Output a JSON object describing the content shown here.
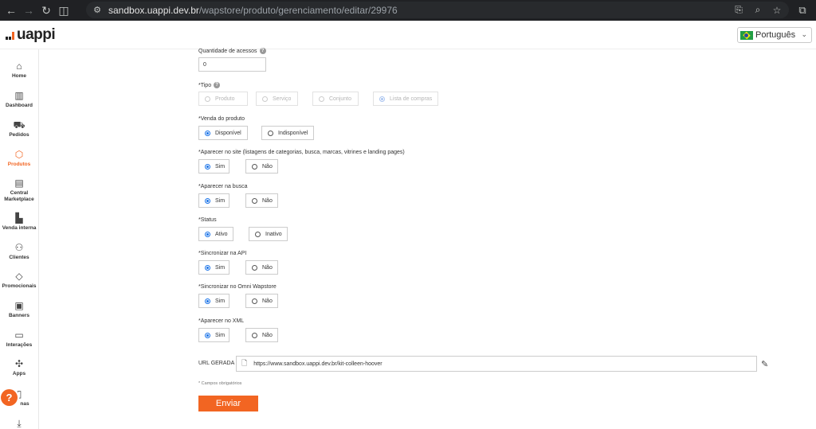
{
  "browser": {
    "url_host": "sandbox.uappi.dev.br",
    "url_path": "/wapstore/produto/gerenciamento/editar/29976"
  },
  "header": {
    "logo_text": "uappi",
    "language": "Português"
  },
  "colors": {
    "brand": "#f26522",
    "radio_checked": "#1a73e8"
  },
  "sidebar": {
    "items": [
      {
        "label": "Home",
        "icon": "home-icon"
      },
      {
        "label": "Dashboard",
        "icon": "chart-icon"
      },
      {
        "label": "Pedidos",
        "icon": "cart-icon"
      },
      {
        "label": "Produtos",
        "icon": "box-icon",
        "active": true
      },
      {
        "label": "Central Marketplace",
        "icon": "store-icon"
      },
      {
        "label": "Venda interna",
        "icon": "register-icon"
      },
      {
        "label": "Clientes",
        "icon": "users-icon"
      },
      {
        "label": "Promocionais",
        "icon": "tag-icon"
      },
      {
        "label": "Banners",
        "icon": "image-icon"
      },
      {
        "label": "Interações",
        "icon": "chat-icon"
      },
      {
        "label": "Apps",
        "icon": "apps-icon"
      },
      {
        "label": "nas",
        "icon": "page-icon"
      },
      {
        "label": "",
        "icon": "download-icon"
      }
    ]
  },
  "form": {
    "qty": {
      "label": "Quantidade de acessos",
      "value": "0"
    },
    "tipo": {
      "label": "*Tipo",
      "options": [
        "Produto",
        "Serviço",
        "Conjunto",
        "Lista de compras"
      ],
      "selected": "Lista de compras"
    },
    "venda": {
      "label": "*Venda do produto",
      "options": [
        "Disponível",
        "Indisponível"
      ],
      "selected": "Disponível"
    },
    "site": {
      "label": "*Aparecer no site (listagens de categorias, busca, marcas, vitrines e landing pages)",
      "options": [
        "Sim",
        "Não"
      ],
      "selected": "Sim"
    },
    "busca": {
      "label": "*Aparecer na busca",
      "options": [
        "Sim",
        "Não"
      ],
      "selected": "Sim"
    },
    "status": {
      "label": "*Status",
      "options": [
        "Ativo",
        "Inativo"
      ],
      "selected": "Ativo"
    },
    "api": {
      "label": "*Sincronizar na API",
      "options": [
        "Sim",
        "Não"
      ],
      "selected": "Sim"
    },
    "omni": {
      "label": "*Sincronizar no Omni Wapstore",
      "options": [
        "Sim",
        "Não"
      ],
      "selected": "Sim"
    },
    "xml": {
      "label": "*Aparecer no XML",
      "options": [
        "Sim",
        "Não"
      ],
      "selected": "Sim"
    },
    "url_gerada": {
      "label": "URL GERADA",
      "value": "https://www.sandbox.uappi.dev.br/kit-colleen-hoover"
    },
    "required_note": "* Campos obrigatórios",
    "submit_label": "Enviar"
  }
}
